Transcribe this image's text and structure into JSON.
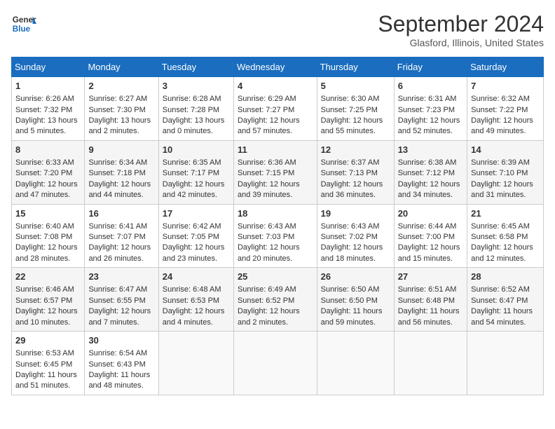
{
  "logo": {
    "line1": "General",
    "line2": "Blue"
  },
  "title": "September 2024",
  "subtitle": "Glasford, Illinois, United States",
  "days_of_week": [
    "Sunday",
    "Monday",
    "Tuesday",
    "Wednesday",
    "Thursday",
    "Friday",
    "Saturday"
  ],
  "weeks": [
    [
      {
        "day": "1",
        "sunrise": "Sunrise: 6:26 AM",
        "sunset": "Sunset: 7:32 PM",
        "daylight": "Daylight: 13 hours and 5 minutes."
      },
      {
        "day": "2",
        "sunrise": "Sunrise: 6:27 AM",
        "sunset": "Sunset: 7:30 PM",
        "daylight": "Daylight: 13 hours and 2 minutes."
      },
      {
        "day": "3",
        "sunrise": "Sunrise: 6:28 AM",
        "sunset": "Sunset: 7:28 PM",
        "daylight": "Daylight: 13 hours and 0 minutes."
      },
      {
        "day": "4",
        "sunrise": "Sunrise: 6:29 AM",
        "sunset": "Sunset: 7:27 PM",
        "daylight": "Daylight: 12 hours and 57 minutes."
      },
      {
        "day": "5",
        "sunrise": "Sunrise: 6:30 AM",
        "sunset": "Sunset: 7:25 PM",
        "daylight": "Daylight: 12 hours and 55 minutes."
      },
      {
        "day": "6",
        "sunrise": "Sunrise: 6:31 AM",
        "sunset": "Sunset: 7:23 PM",
        "daylight": "Daylight: 12 hours and 52 minutes."
      },
      {
        "day": "7",
        "sunrise": "Sunrise: 6:32 AM",
        "sunset": "Sunset: 7:22 PM",
        "daylight": "Daylight: 12 hours and 49 minutes."
      }
    ],
    [
      {
        "day": "8",
        "sunrise": "Sunrise: 6:33 AM",
        "sunset": "Sunset: 7:20 PM",
        "daylight": "Daylight: 12 hours and 47 minutes."
      },
      {
        "day": "9",
        "sunrise": "Sunrise: 6:34 AM",
        "sunset": "Sunset: 7:18 PM",
        "daylight": "Daylight: 12 hours and 44 minutes."
      },
      {
        "day": "10",
        "sunrise": "Sunrise: 6:35 AM",
        "sunset": "Sunset: 7:17 PM",
        "daylight": "Daylight: 12 hours and 42 minutes."
      },
      {
        "day": "11",
        "sunrise": "Sunrise: 6:36 AM",
        "sunset": "Sunset: 7:15 PM",
        "daylight": "Daylight: 12 hours and 39 minutes."
      },
      {
        "day": "12",
        "sunrise": "Sunrise: 6:37 AM",
        "sunset": "Sunset: 7:13 PM",
        "daylight": "Daylight: 12 hours and 36 minutes."
      },
      {
        "day": "13",
        "sunrise": "Sunrise: 6:38 AM",
        "sunset": "Sunset: 7:12 PM",
        "daylight": "Daylight: 12 hours and 34 minutes."
      },
      {
        "day": "14",
        "sunrise": "Sunrise: 6:39 AM",
        "sunset": "Sunset: 7:10 PM",
        "daylight": "Daylight: 12 hours and 31 minutes."
      }
    ],
    [
      {
        "day": "15",
        "sunrise": "Sunrise: 6:40 AM",
        "sunset": "Sunset: 7:08 PM",
        "daylight": "Daylight: 12 hours and 28 minutes."
      },
      {
        "day": "16",
        "sunrise": "Sunrise: 6:41 AM",
        "sunset": "Sunset: 7:07 PM",
        "daylight": "Daylight: 12 hours and 26 minutes."
      },
      {
        "day": "17",
        "sunrise": "Sunrise: 6:42 AM",
        "sunset": "Sunset: 7:05 PM",
        "daylight": "Daylight: 12 hours and 23 minutes."
      },
      {
        "day": "18",
        "sunrise": "Sunrise: 6:43 AM",
        "sunset": "Sunset: 7:03 PM",
        "daylight": "Daylight: 12 hours and 20 minutes."
      },
      {
        "day": "19",
        "sunrise": "Sunrise: 6:43 AM",
        "sunset": "Sunset: 7:02 PM",
        "daylight": "Daylight: 12 hours and 18 minutes."
      },
      {
        "day": "20",
        "sunrise": "Sunrise: 6:44 AM",
        "sunset": "Sunset: 7:00 PM",
        "daylight": "Daylight: 12 hours and 15 minutes."
      },
      {
        "day": "21",
        "sunrise": "Sunrise: 6:45 AM",
        "sunset": "Sunset: 6:58 PM",
        "daylight": "Daylight: 12 hours and 12 minutes."
      }
    ],
    [
      {
        "day": "22",
        "sunrise": "Sunrise: 6:46 AM",
        "sunset": "Sunset: 6:57 PM",
        "daylight": "Daylight: 12 hours and 10 minutes."
      },
      {
        "day": "23",
        "sunrise": "Sunrise: 6:47 AM",
        "sunset": "Sunset: 6:55 PM",
        "daylight": "Daylight: 12 hours and 7 minutes."
      },
      {
        "day": "24",
        "sunrise": "Sunrise: 6:48 AM",
        "sunset": "Sunset: 6:53 PM",
        "daylight": "Daylight: 12 hours and 4 minutes."
      },
      {
        "day": "25",
        "sunrise": "Sunrise: 6:49 AM",
        "sunset": "Sunset: 6:52 PM",
        "daylight": "Daylight: 12 hours and 2 minutes."
      },
      {
        "day": "26",
        "sunrise": "Sunrise: 6:50 AM",
        "sunset": "Sunset: 6:50 PM",
        "daylight": "Daylight: 11 hours and 59 minutes."
      },
      {
        "day": "27",
        "sunrise": "Sunrise: 6:51 AM",
        "sunset": "Sunset: 6:48 PM",
        "daylight": "Daylight: 11 hours and 56 minutes."
      },
      {
        "day": "28",
        "sunrise": "Sunrise: 6:52 AM",
        "sunset": "Sunset: 6:47 PM",
        "daylight": "Daylight: 11 hours and 54 minutes."
      }
    ],
    [
      {
        "day": "29",
        "sunrise": "Sunrise: 6:53 AM",
        "sunset": "Sunset: 6:45 PM",
        "daylight": "Daylight: 11 hours and 51 minutes."
      },
      {
        "day": "30",
        "sunrise": "Sunrise: 6:54 AM",
        "sunset": "Sunset: 6:43 PM",
        "daylight": "Daylight: 11 hours and 48 minutes."
      },
      null,
      null,
      null,
      null,
      null
    ]
  ]
}
